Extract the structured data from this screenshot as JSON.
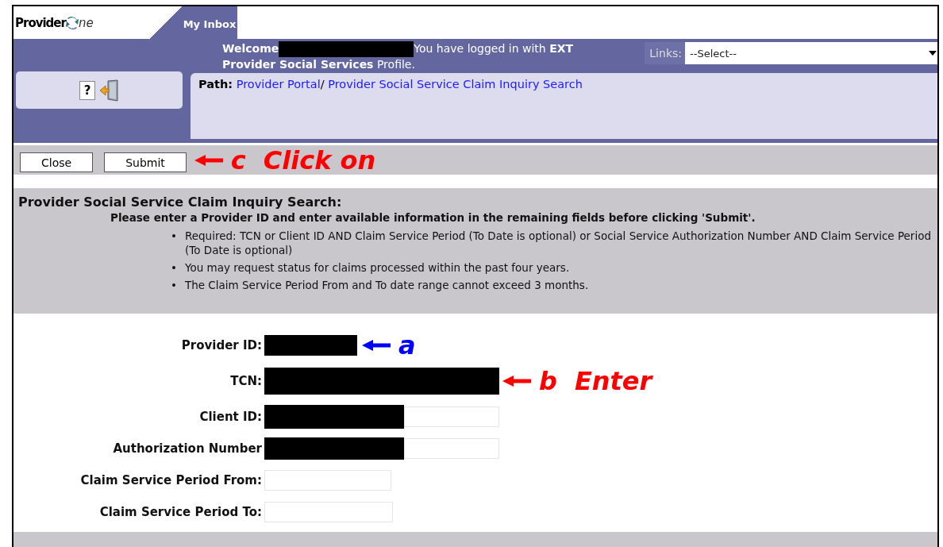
{
  "logo": {
    "prefix": "Provider",
    "suffix": "ne"
  },
  "tabs": [
    {
      "label": "My Inbox",
      "selected": true
    }
  ],
  "welcome": {
    "greeting": "Welcome",
    "redacted": true,
    "message": [
      "You have logged in with **EXT**",
      "**Provider Social Services** Profile."
    ]
  },
  "links": {
    "label": "Links:",
    "value": "--Select--"
  },
  "tool_icons": [
    {
      "kind": "help",
      "glyph": "?"
    },
    {
      "kind": "exit"
    }
  ],
  "path": {
    "label": "Path:",
    "items": [
      "Provider Portal",
      "Provider Social Service Claim Inquiry Search"
    ],
    "separator": "/"
  },
  "buttons": [
    {
      "label": "Close"
    },
    {
      "label": "Submit"
    }
  ],
  "toolbar_annotation": {
    "letter": "c",
    "text": "Click on",
    "color": "#ff0000"
  },
  "info": {
    "title": "Provider Social Service Claim Inquiry Search:",
    "instruction": "Please enter a Provider ID and enter available information in the remaining fields before clicking 'Submit'.",
    "bullet": "•",
    "bullets": [
      "Required: TCN or Client ID AND Claim Service Period (To Date is optional) or Social Service Authorization Number AND Claim Service Period (To Date is optional)",
      "You may request status for claims processed within the past four years.",
      "The Claim Service Period From and To date range cannot exceed 3 months."
    ]
  },
  "fields": [
    {
      "label": "Provider ID:",
      "redacted": true,
      "annotation": {
        "letter": "a",
        "color": "#0000ff"
      }
    },
    {
      "label": "TCN:",
      "redacted": true,
      "annotation": {
        "letter": "b",
        "text": "Enter",
        "color": "#ff0000"
      }
    },
    {
      "label": "Client ID:",
      "redacted": true
    },
    {
      "label": "Authorization Number",
      "redacted": true
    },
    {
      "label": "Claim Service Period From:",
      "redacted": false
    },
    {
      "label": "Claim Service Period To:",
      "redacted": false
    }
  ]
}
